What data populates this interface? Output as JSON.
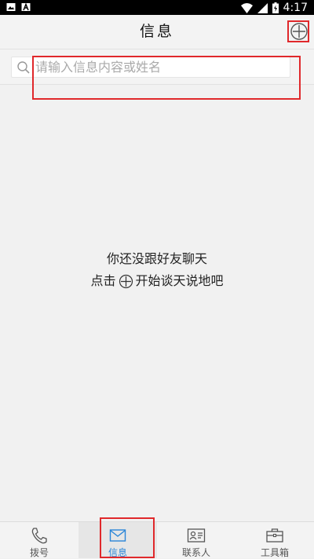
{
  "status_bar": {
    "time": "4:17"
  },
  "header": {
    "title": "信息",
    "add_icon": "plus-circle-icon"
  },
  "search": {
    "placeholder": "请输入信息内容或姓名",
    "value": ""
  },
  "empty_state": {
    "line1": "你还没跟好友聊天",
    "line2_prefix": "点击",
    "line2_suffix": "开始谈天说地吧"
  },
  "bottom_nav": {
    "items": [
      {
        "label": "拨号",
        "icon": "phone-icon"
      },
      {
        "label": "信息",
        "icon": "mail-icon",
        "active": true
      },
      {
        "label": "联系人",
        "icon": "contact-card-icon"
      },
      {
        "label": "工具箱",
        "icon": "toolbox-icon"
      }
    ]
  },
  "colors": {
    "accent": "#2b86d8",
    "highlight": "#e0282b",
    "background": "#f1f1f1"
  }
}
